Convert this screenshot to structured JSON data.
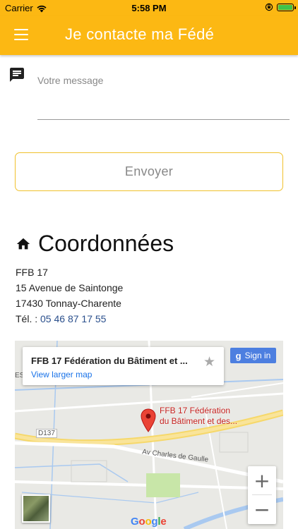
{
  "status_bar": {
    "carrier": "Carrier",
    "time": "5:58 PM",
    "battery_level": 1.0
  },
  "app_bar": {
    "title": "Je contacte ma Fédé",
    "menu_icon": "hamburger-menu-icon"
  },
  "form": {
    "message_placeholder": "Votre message",
    "message_value": "",
    "message_icon": "chat-message-icon",
    "send_label": "Envoyer"
  },
  "contact": {
    "section_title": "Coordonnées",
    "section_icon": "home-icon",
    "org": "FFB 17",
    "street": "15 Avenue de Saintonge",
    "city": "17430 Tonnay-Charente",
    "phone_prefix": "Tél. :",
    "phone": "05 46 87 17 55"
  },
  "map": {
    "card_title": "FFB 17 Fédération du Bâtiment et ...",
    "view_larger": "View larger map",
    "signin_g": "g",
    "signin_label": "Sign in",
    "place_line1": "FFB 17 Fédération",
    "place_line2": "du Bâtiment et des...",
    "road_d137": "D137",
    "road_charles": "Av Charles de Gaulle",
    "road_es": "ES",
    "google_letters": [
      "G",
      "o",
      "o",
      "g",
      "l",
      "e"
    ],
    "zoom_in": "+",
    "zoom_out": "−",
    "colors": {
      "road": "#f6d86a",
      "water": "#a9c9f0",
      "park": "#c8e6a8",
      "pin": "#ea4335"
    }
  }
}
